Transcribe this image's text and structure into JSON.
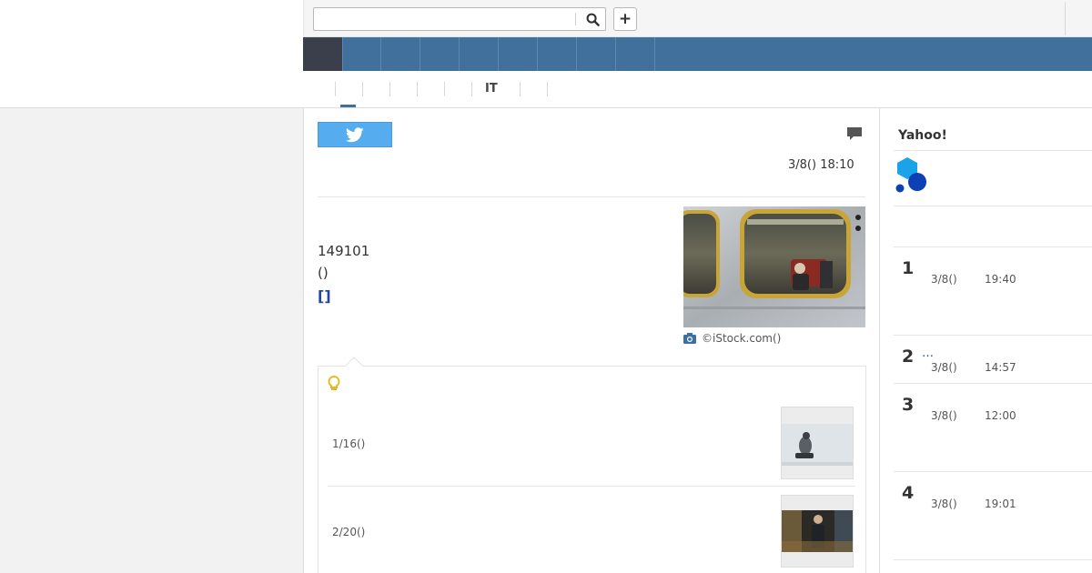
{
  "search": {
    "value": "",
    "placeholder": ""
  },
  "header": {
    "plus_label": "+"
  },
  "subnav": {
    "it_label": "IT"
  },
  "article": {
    "datetime": "3/8() 18:10",
    "line1": "149101",
    "line2": "()",
    "link_text": "[]",
    "photo_credit": "©iStock.com()"
  },
  "related": {
    "items": [
      {
        "date": "1/16()"
      },
      {
        "date": "2/20()"
      }
    ]
  },
  "sidebar": {
    "title": "Yahoo!",
    "ranking": [
      {
        "rank": "1",
        "more": "",
        "date": "3/8()",
        "time": "19:40"
      },
      {
        "rank": "2",
        "more": "…",
        "date": "3/8()",
        "time": "14:57"
      },
      {
        "rank": "3",
        "more": "",
        "date": "3/8()",
        "time": "12:00"
      },
      {
        "rank": "4",
        "more": "",
        "date": "3/8()",
        "time": "19:01"
      }
    ]
  },
  "colors": {
    "nav_bg": "#41709d",
    "nav_home": "#3b3f4c",
    "tweet_blue": "#55acee",
    "link_blue": "#1f47a3",
    "bulb_yellow": "#e6b81e",
    "logo_cyan": "#1aa3e8",
    "logo_navy": "#0d3fb5"
  }
}
